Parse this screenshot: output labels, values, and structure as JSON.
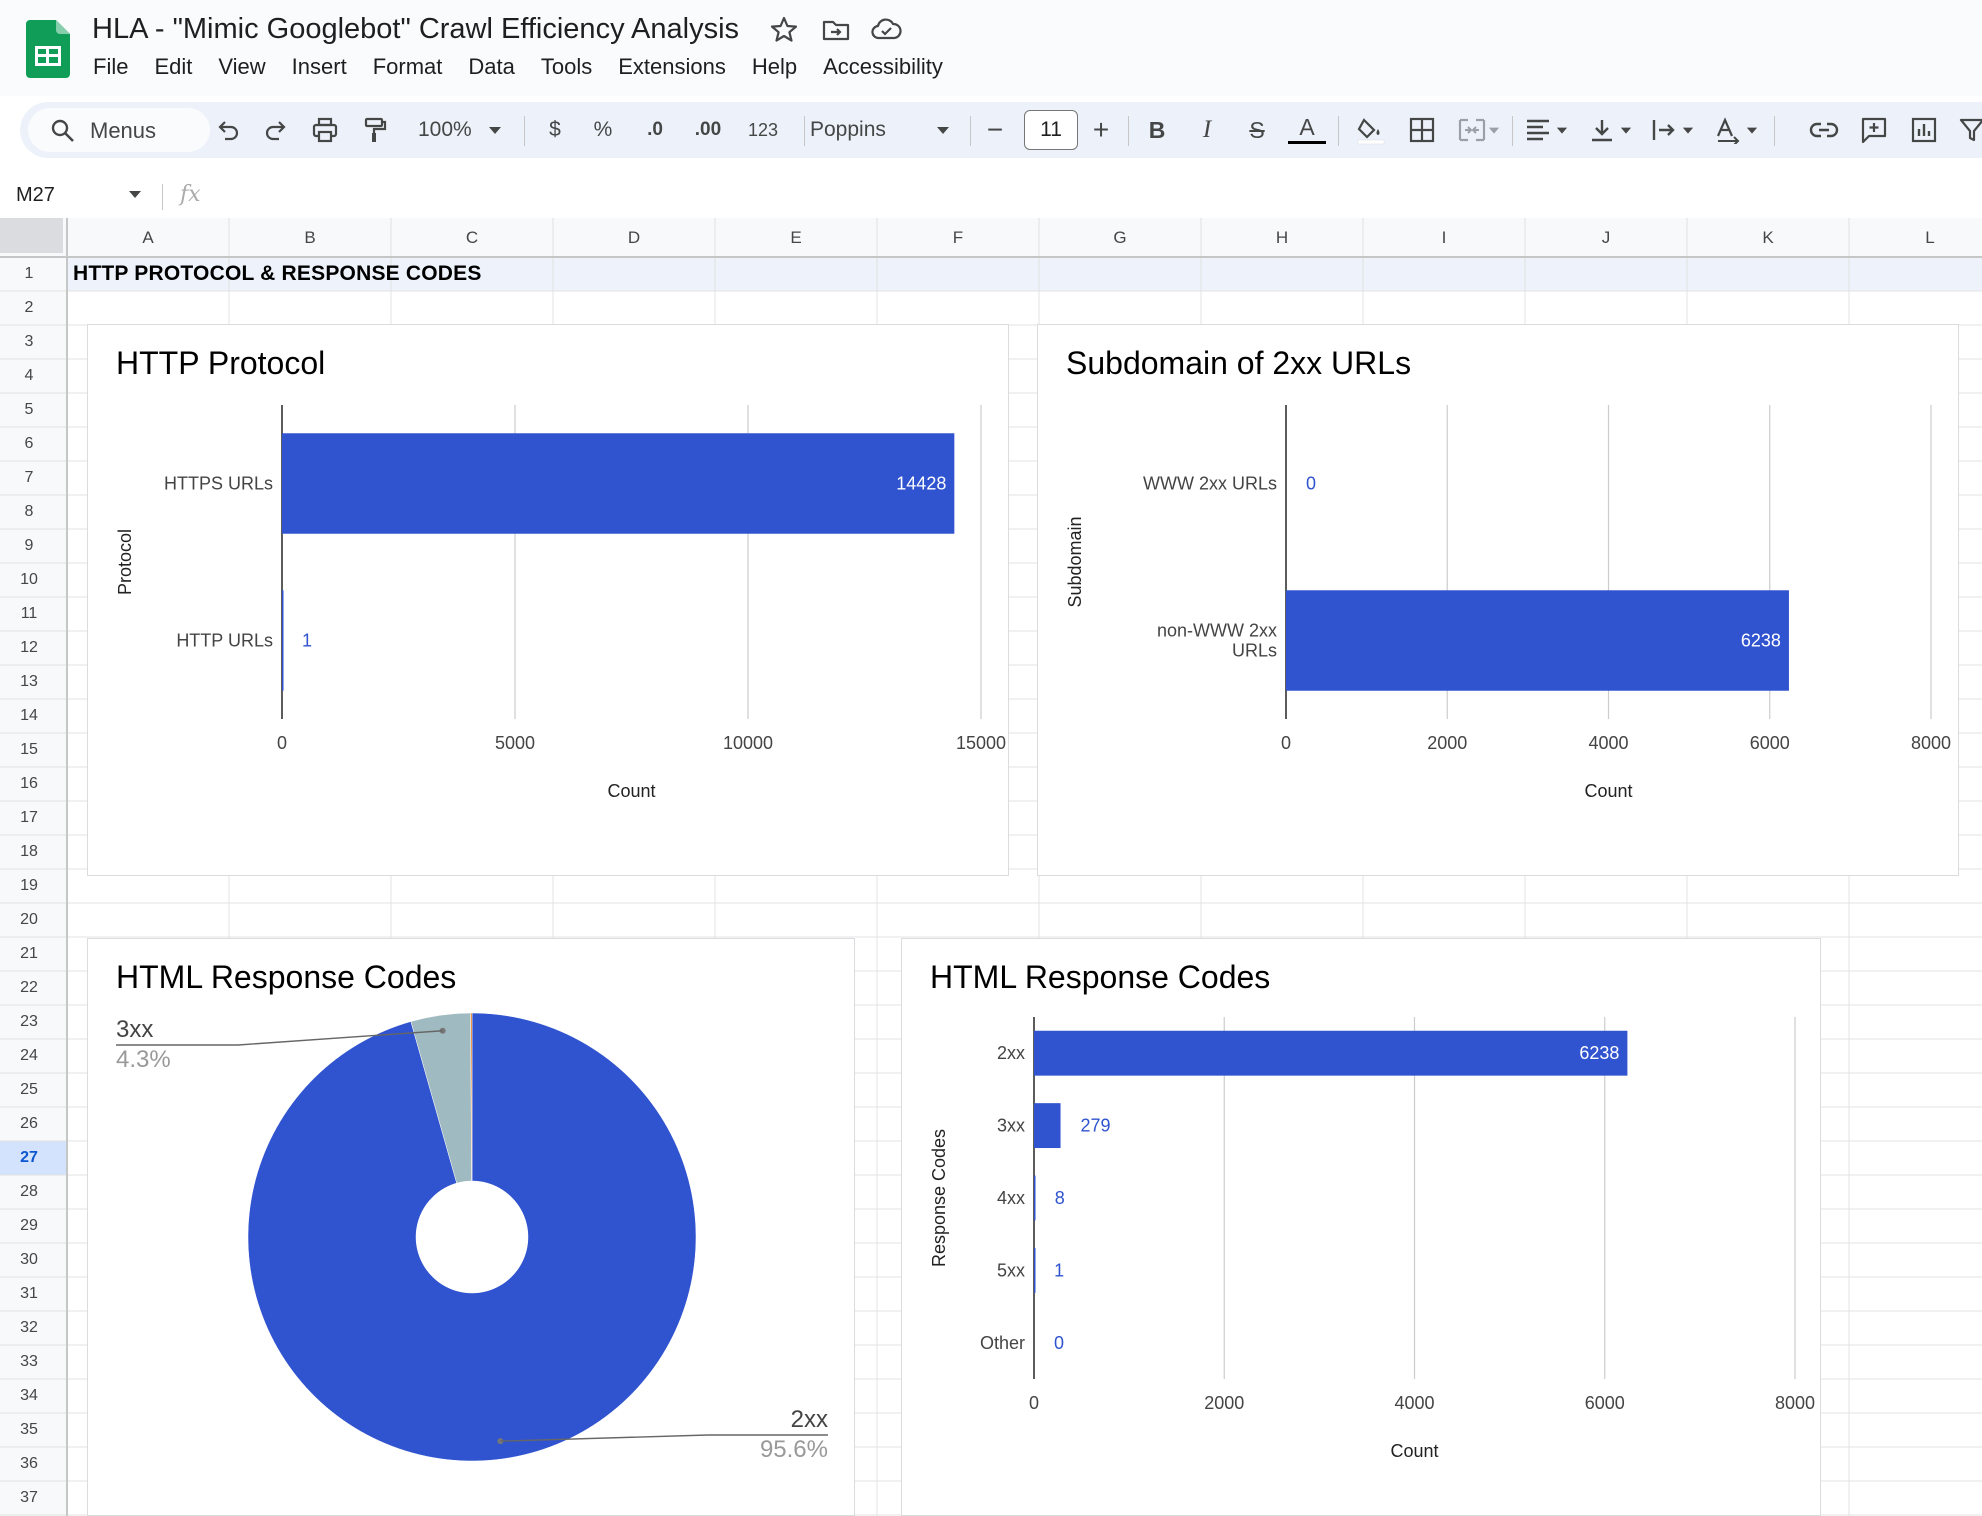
{
  "header": {
    "title": "HLA - \"Mimic Googlebot\" Crawl Efficiency Analysis",
    "menu": [
      "File",
      "Edit",
      "View",
      "Insert",
      "Format",
      "Data",
      "Tools",
      "Extensions",
      "Help",
      "Accessibility"
    ]
  },
  "toolbar": {
    "menus_label": "Menus",
    "zoom": "100%",
    "currency": "$",
    "percent": "%",
    "dec_decrease": ".0",
    "dec_increase": ".00",
    "number_format": "123",
    "font": "Poppins",
    "font_size": "11",
    "minus": "−",
    "plus": "+",
    "bold": "B",
    "italic": "I",
    "strike": "S",
    "text_color": "A"
  },
  "formula_bar": {
    "cell_ref": "M27",
    "fx": "fx"
  },
  "grid": {
    "columns": [
      "A",
      "B",
      "C",
      "D",
      "E",
      "F",
      "G",
      "H",
      "I",
      "J",
      "K",
      "L"
    ],
    "rows": [
      "1",
      "2",
      "3",
      "4",
      "5",
      "6",
      "7",
      "8",
      "9",
      "10",
      "11",
      "12",
      "13",
      "14",
      "15",
      "16",
      "17",
      "18",
      "19",
      "20",
      "21",
      "22",
      "23",
      "24",
      "25",
      "26",
      "27",
      "28",
      "29",
      "30",
      "31",
      "32",
      "33",
      "34",
      "35",
      "36",
      "37"
    ],
    "selected_row": "27",
    "a1": "HTTP PROTOCOL & RESPONSE CODES"
  },
  "colors": {
    "bar": "#3053cf",
    "pie_secondary": "#9fbac1",
    "selection_bg": "#d3e3fd",
    "header_bg": "#f8f9fa"
  },
  "chart_data": [
    {
      "type": "bar",
      "orientation": "horizontal",
      "title": "HTTP Protocol",
      "xlabel": "Count",
      "ylabel": "Protocol",
      "categories": [
        "HTTPS URLs",
        "HTTP URLs"
      ],
      "values": [
        14428,
        1
      ],
      "xlim": [
        0,
        15000
      ],
      "xticks": [
        "0",
        "5000",
        "10000",
        "15000"
      ],
      "grid": true,
      "legend": "none"
    },
    {
      "type": "bar",
      "orientation": "horizontal",
      "title": "Subdomain of 2xx URLs",
      "xlabel": "Count",
      "ylabel": "Subdomain",
      "categories": [
        [
          "WWW 2xx URLs"
        ],
        [
          "non-WWW 2xx",
          "URLs"
        ]
      ],
      "values": [
        0,
        6238
      ],
      "xlim": [
        0,
        8000
      ],
      "xticks": [
        "0",
        "2000",
        "4000",
        "6000",
        "8000"
      ],
      "grid": true,
      "legend": "none"
    },
    {
      "type": "pie",
      "title": "HTML Response Codes",
      "donut_hole": true,
      "slices": [
        {
          "label": "2xx",
          "percent_label": "95.6%",
          "value": 95.6
        },
        {
          "label": "3xx",
          "percent_label": "4.3%",
          "value": 4.3
        },
        {
          "label": "",
          "percent_label": "",
          "value": 0.1
        }
      ],
      "legend": "labeled"
    },
    {
      "type": "bar",
      "orientation": "horizontal",
      "title": "HTML Response Codes",
      "xlabel": "Count",
      "ylabel": "Response Codes",
      "categories": [
        "2xx",
        "3xx",
        "4xx",
        "5xx",
        "Other"
      ],
      "values": [
        6238,
        279,
        8,
        1,
        0
      ],
      "xlim": [
        0,
        8000
      ],
      "xticks": [
        "0",
        "2000",
        "4000",
        "6000",
        "8000"
      ],
      "grid": true,
      "legend": "none"
    }
  ]
}
